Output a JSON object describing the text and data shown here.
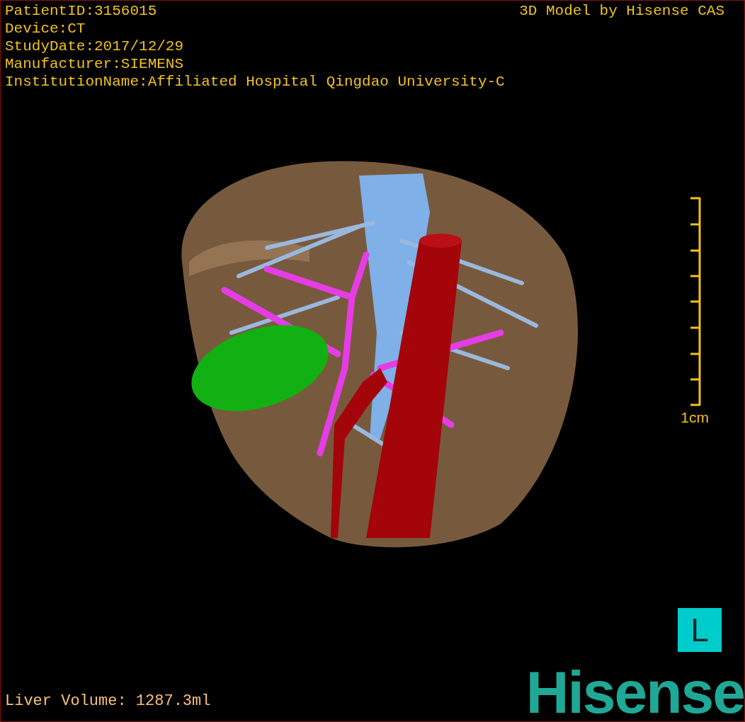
{
  "patient_info": [
    "PatientID:3156015",
    "Device:CT",
    "StudyDate:2017/12/29",
    "Manufacturer:SIEMENS",
    "InstitutionName:Affiliated Hospital Qingdao University-C"
  ],
  "model_caption": "3D Model by Hisense CAS",
  "scale_bar": {
    "label": "1cm"
  },
  "liver_volume": "Liver Volume: 1287.3ml",
  "orientation_marker": "L",
  "logo": "Hisense"
}
